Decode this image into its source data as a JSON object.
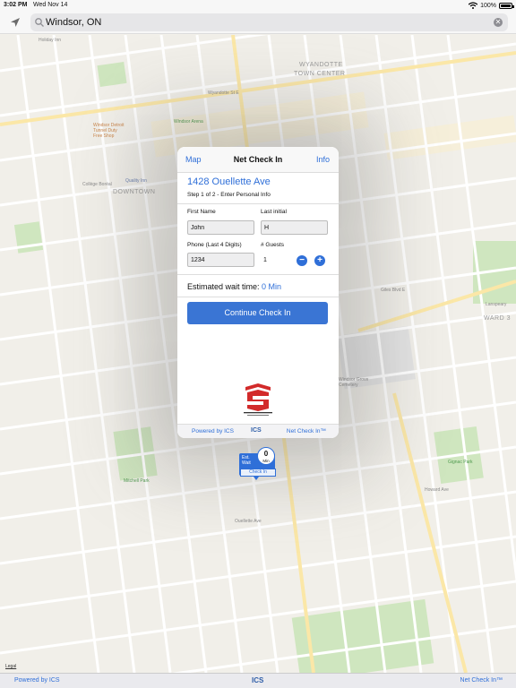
{
  "status_bar": {
    "time": "3:02 PM",
    "date": "Wed Nov 14",
    "battery": "100%"
  },
  "search": {
    "value": "Windsor, ON",
    "placeholder": "Search"
  },
  "map": {
    "labels": {
      "wyandotte": "WYANDOTTE",
      "town_center": "TOWN CENTER",
      "downtown": "DOWNTOWN",
      "ward3": "WARD 3",
      "windsor_arena": "Windsor Arena",
      "tunnel_shop": "Windsor Detroit Tunnel Duty Free Shop",
      "college_boreal": "Collège Boréal",
      "quality_inn": "Quality Inn",
      "lanspeary": "Lanspeary",
      "windsor_grove": "Windsor Grove Cemetery",
      "mitchell_park": "Mitchell Park",
      "gignac_park": "Gignac Park",
      "holiday_inn": "Holiday Inn",
      "giles": "Giles Blvd E",
      "howard": "Howard Ave",
      "wyandotte_st": "Wyandotte St E",
      "ouellette": "Ouellette Ave"
    },
    "legal": "Legal"
  },
  "dialog": {
    "nav": {
      "back_label": "Map",
      "title": "Net Check In",
      "info_label": "Info"
    },
    "address": "1428 Ouellette Ave",
    "step": "Step 1 of 2 - Enter Personal Info",
    "first_name": {
      "label": "First Name",
      "value": "John"
    },
    "last_initial": {
      "label": "Last initial",
      "value": "H"
    },
    "phone": {
      "label": "Phone (Last 4 Digits)",
      "value": "1234"
    },
    "guests": {
      "label": "# Guests",
      "value": "1",
      "minus": "−",
      "plus": "+"
    },
    "wait": {
      "label": "Estimated wait time:",
      "value": "0 Min"
    },
    "continue_label": "Continue Check In",
    "logo_text": "MEDICAL LABORATORIES OF WINDSOR LTD.",
    "footer": {
      "powered": "Powered by ICS",
      "ics": "ICS",
      "brand": "Net Check In™"
    }
  },
  "pin": {
    "label": "Est. Wait",
    "count": "0",
    "unit": "Min",
    "checkin": "Check In"
  },
  "bottom_bar": {
    "powered": "Powered by ICS",
    "ics": "ICS",
    "brand": "Net Check In™"
  },
  "colors": {
    "accent": "#2f6fd8",
    "logo_red": "#d22a2a",
    "park_green": "#cfe6bf"
  }
}
